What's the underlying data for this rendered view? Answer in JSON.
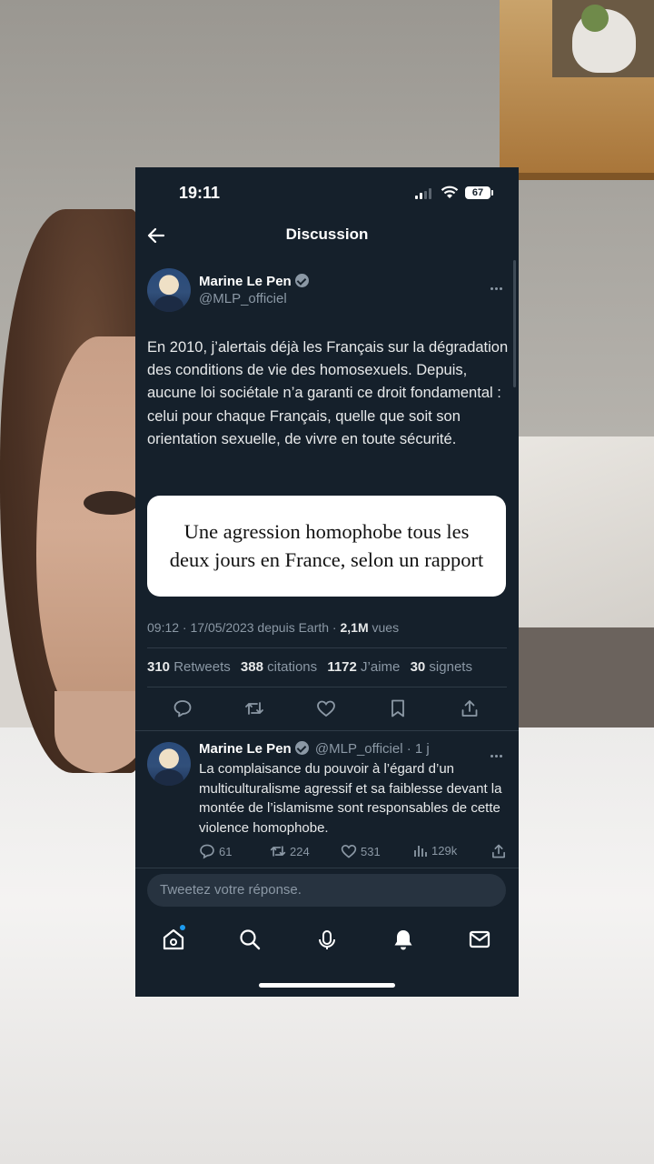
{
  "status_bar": {
    "time": "19:11",
    "battery": "67"
  },
  "header": {
    "title": "Discussion"
  },
  "tweet": {
    "author": "Marine Le Pen",
    "handle": "@MLP_officiel",
    "text": "En 2010, j’alertais déjà les Français sur la dégradation des conditions de vie des homosexuels. Depuis, aucune loi sociétale n’a garanti ce droit fondamental : celui pour chaque Français, quelle que soit son orientation sexuelle, de vivre en toute sécurité.",
    "card_text": "Une agression homophobe tous les deux jours en France, selon un rapport",
    "meta_prefix": "09:12 · 17/05/2023 depuis Earth · ",
    "views": "2,1M",
    "views_label": " vues",
    "stats": {
      "retweets": "310",
      "retweets_label": "Retweets",
      "quotes": "388",
      "quotes_label": "citations",
      "likes": "1172",
      "likes_label": "J’aime",
      "bookmarks": "30",
      "bookmarks_label": "signets"
    }
  },
  "reply": {
    "author": "Marine Le Pen",
    "handle_time": "@MLP_officiel · 1 j",
    "text": "La complaisance du pouvoir à l’égard d’un multiculturalisme agressif et sa faiblesse devant la montée de l’islamisme sont responsables de cette violence homophobe.",
    "replies": "61",
    "retweets": "224",
    "likes": "531",
    "views": "129k"
  },
  "composer": {
    "placeholder": "Tweetez votre réponse."
  },
  "colors": {
    "background": "#15202b",
    "text": "#e7e9ea",
    "muted": "#8b98a5",
    "accent": "#1d9bf0"
  },
  "icons": [
    "back-arrow-icon",
    "verified-badge-icon",
    "more-icon",
    "reply-icon",
    "retweet-icon",
    "like-icon",
    "bookmark-icon",
    "share-icon",
    "views-icon",
    "home-icon",
    "search-icon",
    "spaces-icon",
    "notifications-icon",
    "messages-icon"
  ]
}
